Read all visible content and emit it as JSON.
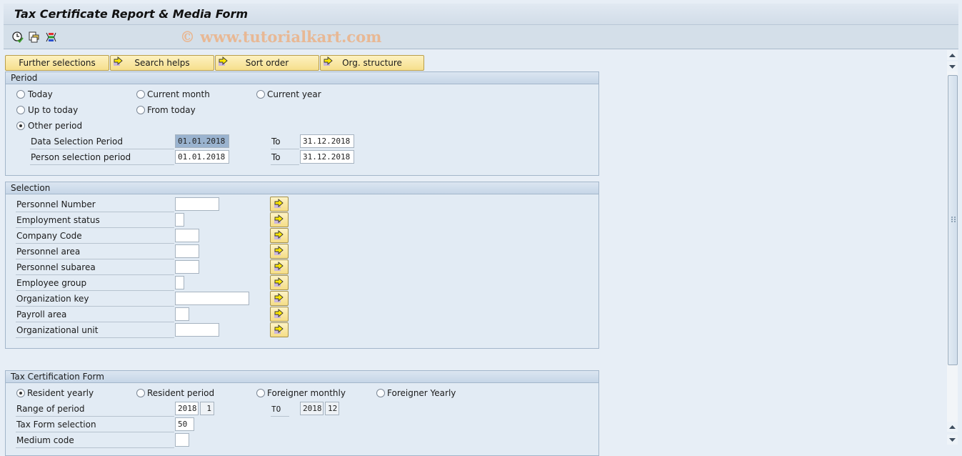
{
  "window": {
    "title": "Tax Certificate Report & Media Form",
    "watermark": "© www.tutorialkart.com"
  },
  "app_toolbar": {
    "icons": [
      "execute-clock-icon",
      "get-variant-icon",
      "selection-options-icon"
    ]
  },
  "tab_buttons": [
    {
      "label": "Further selections",
      "icon": null
    },
    {
      "label": "Search helps",
      "icon": "arrow-right-icon"
    },
    {
      "label": "Sort order",
      "icon": "arrow-right-icon"
    },
    {
      "label": "Org. structure",
      "icon": "arrow-right-icon"
    }
  ],
  "period": {
    "title": "Period",
    "radios": [
      {
        "label": "Today",
        "selected": false
      },
      {
        "label": "Current month",
        "selected": false
      },
      {
        "label": "Current year",
        "selected": false
      },
      {
        "label": "Up to today",
        "selected": false
      },
      {
        "label": "From today",
        "selected": false
      },
      {
        "label": "Other period",
        "selected": true
      }
    ],
    "rows": [
      {
        "label": "Data Selection Period",
        "from": "01.01.2018",
        "to_label": "To",
        "to": "31.12.2018"
      },
      {
        "label": "Person selection period",
        "from": "01.01.2018",
        "to_label": "To",
        "to": "31.12.2018"
      }
    ]
  },
  "selection": {
    "title": "Selection",
    "fields": [
      {
        "label": "Personnel Number",
        "value": ""
      },
      {
        "label": "Employment status",
        "value": ""
      },
      {
        "label": "Company Code",
        "value": ""
      },
      {
        "label": "Personnel area",
        "value": ""
      },
      {
        "label": "Personnel subarea",
        "value": ""
      },
      {
        "label": "Employee group",
        "value": ""
      },
      {
        "label": "Organization key",
        "value": ""
      },
      {
        "label": "Payroll area",
        "value": ""
      },
      {
        "label": "Organizational unit",
        "value": ""
      }
    ]
  },
  "tax_form": {
    "title": "Tax Certification Form",
    "radios": [
      {
        "label": "Resident yearly",
        "selected": true
      },
      {
        "label": "Resident period",
        "selected": false
      },
      {
        "label": "Foreigner monthly",
        "selected": false
      },
      {
        "label": "Foreigner Yearly",
        "selected": false
      }
    ],
    "range": {
      "label": "Range of period",
      "from_year": "2018",
      "from_month": "1",
      "to_label": "TO",
      "to_year": "2018",
      "to_month": "12"
    },
    "form_selection": {
      "label": "Tax Form selection",
      "value": "50"
    },
    "medium_code": {
      "label": "Medium code",
      "value": ""
    }
  }
}
